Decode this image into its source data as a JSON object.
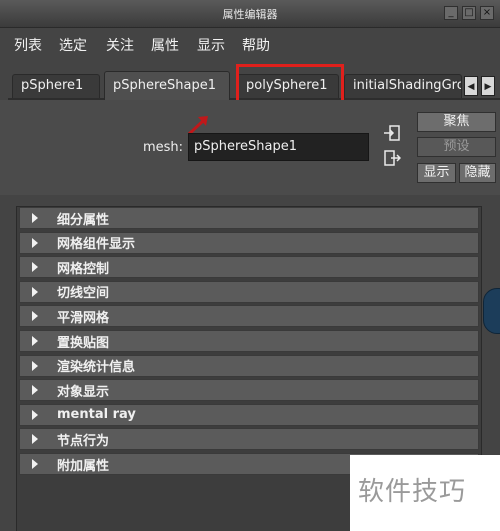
{
  "window": {
    "title": "属性编辑器"
  },
  "menu": [
    "列表",
    "选定",
    "关注",
    "属性",
    "显示",
    "帮助"
  ],
  "tabs": [
    {
      "label": "pSphere1",
      "active": false
    },
    {
      "label": "pSphereShape1",
      "active": true
    },
    {
      "label": "polySphere1",
      "active": false
    },
    {
      "label": "initialShadingGrou",
      "active": false
    }
  ],
  "mesh": {
    "label": "mesh:",
    "value": "pSphereShape1"
  },
  "buttons": {
    "focus": "聚焦",
    "presets": "预设",
    "show": "显示",
    "hide": "隐藏"
  },
  "sections": [
    "细分属性",
    "网格组件显示",
    "网格控制",
    "切线空间",
    "平滑网格",
    "置换贴图",
    "渲染统计信息",
    "对象显示",
    "mental ray",
    "节点行为",
    "附加属性"
  ],
  "watermark": "软件技巧",
  "colors": {
    "highlight_box": "#e0201c",
    "arrow": "#c0181a",
    "background": "#444444"
  }
}
